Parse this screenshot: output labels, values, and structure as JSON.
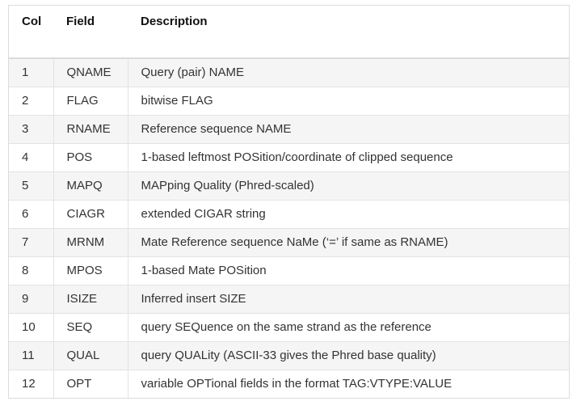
{
  "table": {
    "headers": [
      "Col",
      "Field",
      "Description"
    ],
    "rows": [
      {
        "col": "1",
        "field": "QNAME",
        "description": "Query (pair) NAME"
      },
      {
        "col": "2",
        "field": "FLAG",
        "description": "bitwise FLAG"
      },
      {
        "col": "3",
        "field": "RNAME",
        "description": "Reference sequence NAME"
      },
      {
        "col": "4",
        "field": "POS",
        "description": "1-based leftmost POSition/coordinate of clipped sequence"
      },
      {
        "col": "5",
        "field": "MAPQ",
        "description": "MAPping Quality (Phred-scaled)"
      },
      {
        "col": "6",
        "field": "CIAGR",
        "description": "extended CIGAR string"
      },
      {
        "col": "7",
        "field": "MRNM",
        "description": "Mate Reference sequence NaMe (‘=’ if same as RNAME)"
      },
      {
        "col": "8",
        "field": "MPOS",
        "description": "1-based Mate POSition"
      },
      {
        "col": "9",
        "field": "ISIZE",
        "description": "Inferred insert SIZE"
      },
      {
        "col": "10",
        "field": "SEQ",
        "description": "query SEQuence on the same strand as the reference"
      },
      {
        "col": "11",
        "field": "QUAL",
        "description": "query QUALity (ASCII-33 gives the Phred base quality)"
      },
      {
        "col": "12",
        "field": "OPT",
        "description": "variable OPTional fields in the format TAG:VTYPE:VALUE"
      }
    ]
  }
}
